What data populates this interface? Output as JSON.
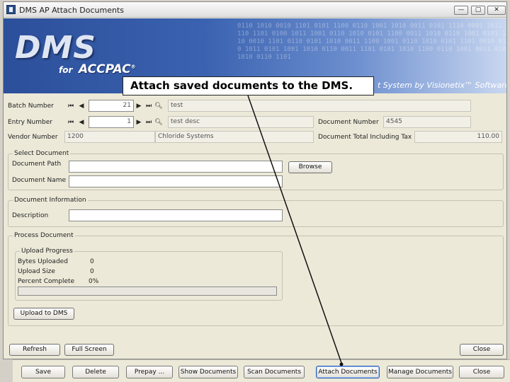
{
  "window": {
    "title": "DMS AP Attach Documents",
    "controls": {
      "minimize": "—",
      "maximize": "▢",
      "close": "✕"
    }
  },
  "banner": {
    "logo": "DMS",
    "for_text": "for",
    "accpac": "ACCPAC",
    "tagline": "t System by Visionetix™ Software",
    "binary_text": "0110 1010 0010 1101 0101 1100 0110 1001 1010 0011 0101 1110 0001 1011 0110 1101 0100 1011 1001 0110 1010 0101 1100 0011 1010 0110 1001 0101 1110 0010 1101 0110 0101 1010 0011 1100 1001 0110 1010 0101 1101 0010 0110 1011 0101 1001 1010 0110 0011 1101 0101 1010 1100 0110 1001 0011 0101 1010 0110 1101"
  },
  "callout": "Attach saved documents to the DMS.",
  "header_fields": {
    "batch_number": {
      "label": "Batch Number",
      "value": "21",
      "desc": "test"
    },
    "entry_number": {
      "label": "Entry Number",
      "value": "1",
      "desc": "test desc"
    },
    "vendor_number": {
      "label": "Vendor Number",
      "value": "1200",
      "desc": "Chloride Systems"
    },
    "document_number": {
      "label": "Document Number",
      "value": "4545"
    },
    "document_total": {
      "label": "Document Total Including Tax",
      "value": "110.00"
    }
  },
  "select_document": {
    "title": "Select Document",
    "path_label": "Document Path",
    "path_value": "",
    "name_label": "Document Name",
    "name_value": "",
    "browse": "Browse"
  },
  "document_information": {
    "title": "Document Information",
    "description_label": "Description",
    "description_value": ""
  },
  "process_document": {
    "title": "Process Document",
    "progress_title": "Upload Progress",
    "bytes_uploaded_label": "Bytes Uploaded",
    "bytes_uploaded_value": "0",
    "upload_size_label": "Upload Size",
    "upload_size_value": "0",
    "percent_label": "Percent Complete",
    "percent_value": "0%",
    "progress_fraction": 0,
    "upload_button": "Upload to DMS"
  },
  "dialog_buttons": {
    "refresh": "Refresh",
    "full_screen": "Full Screen",
    "close": "Close"
  },
  "bottom_toolbar": [
    "Save",
    "Delete",
    "Prepay ...",
    "Show Documents",
    "Scan Documents",
    "Attach Documents",
    "Manage Documents",
    "Close"
  ],
  "colors": {
    "banner": "#2c4f9a",
    "callout_border": "#222222",
    "dialog_bg": "#ece9d8"
  },
  "icons": {
    "first": "first-record-icon",
    "prev": "previous-record-icon",
    "next": "next-record-icon",
    "last": "last-record-icon",
    "finder": "finder-icon"
  }
}
